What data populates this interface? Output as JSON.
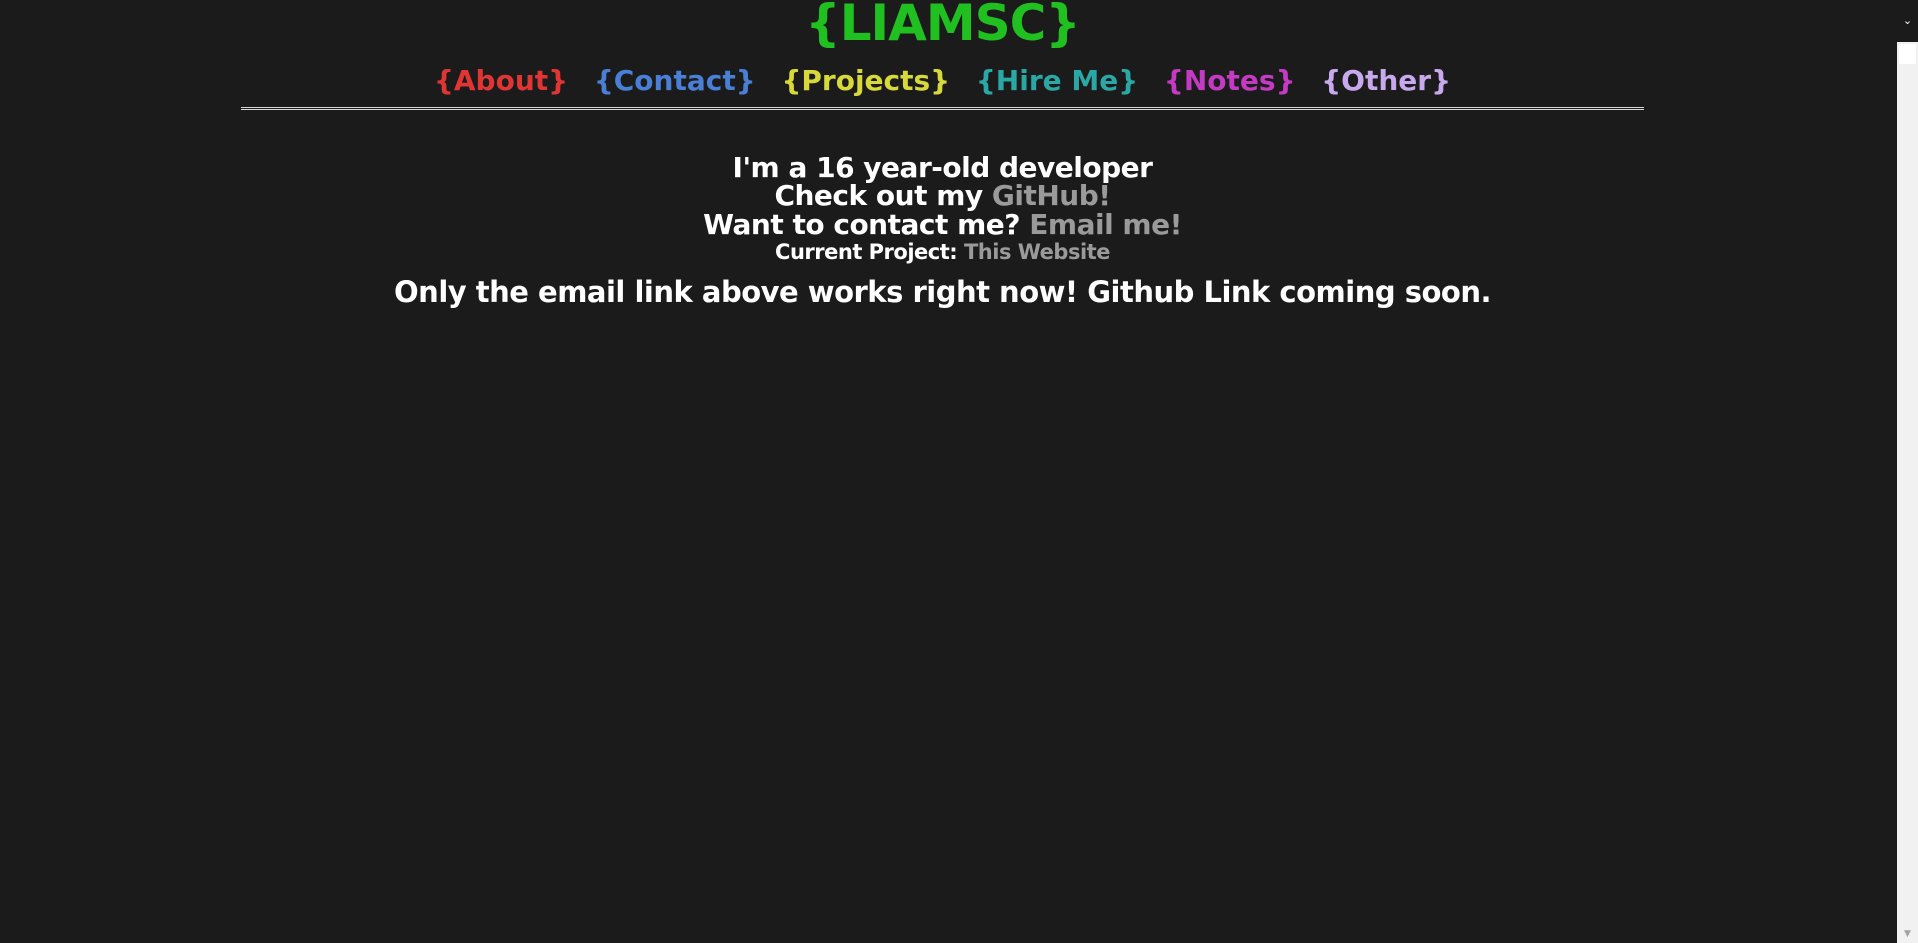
{
  "header": {
    "title": "{LIAMSC}",
    "title_color": "#1fc01f"
  },
  "nav": {
    "items": [
      {
        "label": "{About}",
        "color": "#e03535"
      },
      {
        "label": "{Contact}",
        "color": "#4a7fd6"
      },
      {
        "label": "{Projects}",
        "color": "#d7d83a"
      },
      {
        "label": "{Hire Me}",
        "color": "#2aa8a6"
      },
      {
        "label": "{Notes}",
        "color": "#c33bc3"
      },
      {
        "label": "{Other}",
        "color": "#c9a9ee"
      }
    ]
  },
  "main": {
    "intro": "I'm a 16 year-old developer",
    "github_prefix": "Check out my",
    "github_link": "GitHub!",
    "contact_prefix": "Want to contact me?",
    "email_link": "Email me!",
    "project_label": "Current Project:",
    "project_link": "This Website",
    "notice": "Only the email link above works right now! Github Link coming soon."
  },
  "scrollbar": {
    "up_icon": "chevron-down-icon",
    "down_icon": "arrow-down-icon"
  },
  "colors": {
    "background": "#1b1b1b",
    "text": "#ffffff",
    "link": "#9a9a9a"
  }
}
